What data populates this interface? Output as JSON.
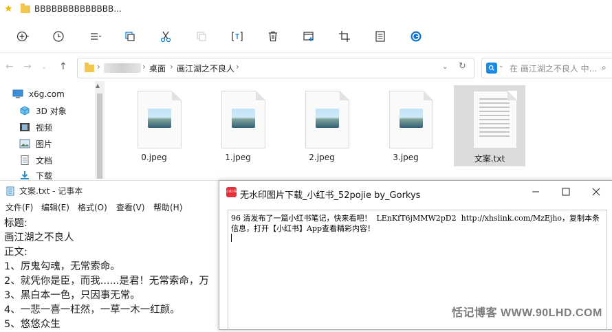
{
  "explorer": {
    "title": "BBBBBBBBBBBBBB...",
    "breadcrumb": [
      "桌面",
      "画江湖之不良人"
    ],
    "search_placeholder": "在 画江湖之不良人 中...",
    "nav_items": [
      "x6g.com",
      "3D 对象",
      "视频",
      "图片",
      "文档",
      "下载"
    ],
    "files": [
      {
        "name": "0.jpeg"
      },
      {
        "name": "1.jpeg"
      },
      {
        "name": "2.jpeg"
      },
      {
        "name": "3.jpeg"
      },
      {
        "name": "文案.txt"
      }
    ]
  },
  "notepad": {
    "title": "文案.txt - 记事本",
    "menu": [
      "文件(F)",
      "编辑(E)",
      "格式(O)",
      "查看(V)",
      "帮助(H)"
    ],
    "lines": [
      "标题:",
      "画江湖之不良人",
      "正文:",
      "1、厉鬼勾魂，无常索命。",
      "2、就凭你是臣，而我......是君！无常索命，万",
      "3、黑白本一色，只因事无常。",
      "4、一悲一喜一枉然，一草一木一红颜。",
      "5、悠悠众生"
    ]
  },
  "dialog": {
    "logo_text": "小红书",
    "title": "无水印图片下载_小红书_52pojie  by_Gorkys",
    "content": "96 清发布了一篇小红书笔记，快来看吧！  LEnKfT6jMMW2pD2  http://xhslink.com/MzEjho，复制本条信息，打开【小红书】App查看精彩内容！"
  },
  "watermark": "恬记博客 WWW.90LHD.COM",
  "colors": {
    "accent": "#0078d7",
    "folder": "#f3c64f",
    "selection": "#cce4f7",
    "logo": "#e5303c"
  }
}
